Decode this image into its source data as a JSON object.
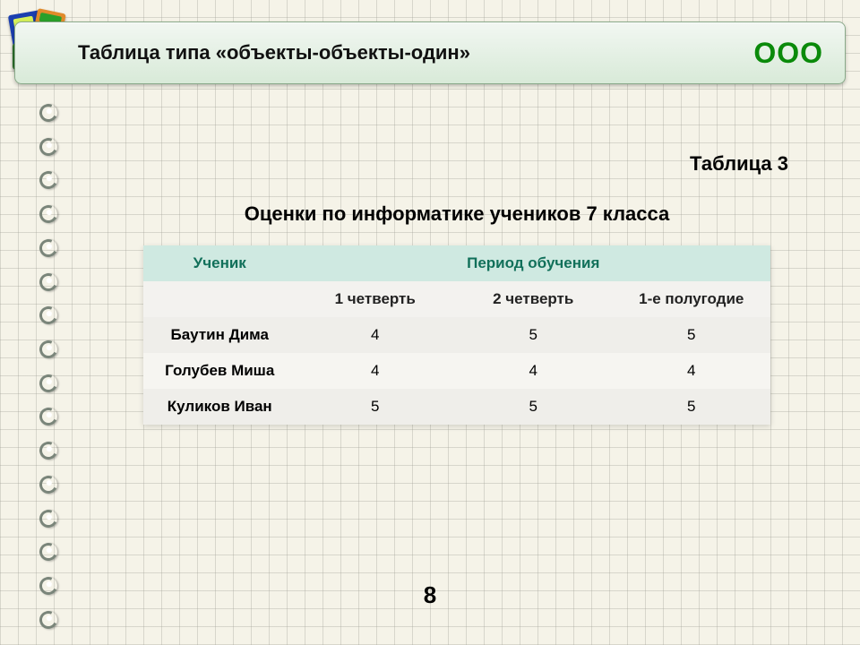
{
  "banner": {
    "title": "Таблица типа «объекты-объекты-один»",
    "badge": "ООО"
  },
  "table_label": "Таблица 3",
  "subtitle": "Оценки по информатике учеников 7 класса",
  "headers": {
    "student": "Ученик",
    "period": "Период обучения",
    "sub": [
      "1 четверть",
      "2 четверть",
      "1-е полугодие"
    ]
  },
  "rows": [
    {
      "name": "Баутин Дима",
      "v": [
        "4",
        "5",
        "5"
      ]
    },
    {
      "name": "Голубев Миша",
      "v": [
        "4",
        "4",
        "4"
      ]
    },
    {
      "name": "Куликов Иван",
      "v": [
        "5",
        "5",
        "5"
      ]
    }
  ],
  "page_number": "8",
  "chart_data": {
    "type": "table",
    "title": "Оценки по информатике учеников 7 класса",
    "columns": [
      "Ученик",
      "1 четверть",
      "2 четверть",
      "1-е полугодие"
    ],
    "data": [
      [
        "Баутин Дима",
        4,
        5,
        5
      ],
      [
        "Голубев Миша",
        4,
        4,
        4
      ],
      [
        "Куликов Иван",
        5,
        5,
        5
      ]
    ]
  }
}
